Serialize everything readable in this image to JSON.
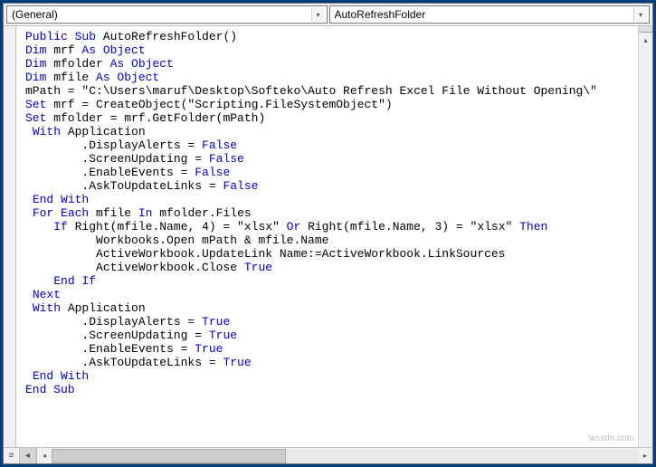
{
  "toolbar": {
    "object_dropdown": "(General)",
    "procedure_dropdown": "AutoRefreshFolder"
  },
  "code": {
    "lines": [
      [
        [
          "kw",
          "Public Sub"
        ],
        [
          "tok",
          " AutoRefreshFolder()"
        ]
      ],
      [
        [
          "kw",
          "Dim"
        ],
        [
          "tok",
          " mrf "
        ],
        [
          "kw",
          "As Object"
        ]
      ],
      [
        [
          "kw",
          "Dim"
        ],
        [
          "tok",
          " mfolder "
        ],
        [
          "kw",
          "As Object"
        ]
      ],
      [
        [
          "kw",
          "Dim"
        ],
        [
          "tok",
          " mfile "
        ],
        [
          "kw",
          "As Object"
        ]
      ],
      [
        [
          "tok",
          "mPath = \"C:\\Users\\maruf\\Desktop\\Softeko\\Auto Refresh Excel File Without Opening\\\""
        ]
      ],
      [
        [
          "kw",
          "Set"
        ],
        [
          "tok",
          " mrf = CreateObject(\"Scripting.FileSystemObject\")"
        ]
      ],
      [
        [
          "kw",
          "Set"
        ],
        [
          "tok",
          " mfolder = mrf.GetFolder(mPath)"
        ]
      ],
      [
        [
          "tok",
          " "
        ],
        [
          "kw",
          "With"
        ],
        [
          "tok",
          " Application"
        ]
      ],
      [
        [
          "tok",
          "        .DisplayAlerts = "
        ],
        [
          "kw",
          "False"
        ]
      ],
      [
        [
          "tok",
          "        .ScreenUpdating = "
        ],
        [
          "kw",
          "False"
        ]
      ],
      [
        [
          "tok",
          "        .EnableEvents = "
        ],
        [
          "kw",
          "False"
        ]
      ],
      [
        [
          "tok",
          "        .AskToUpdateLinks = "
        ],
        [
          "kw",
          "False"
        ]
      ],
      [
        [
          "tok",
          " "
        ],
        [
          "kw",
          "End With"
        ]
      ],
      [
        [
          "tok",
          " "
        ],
        [
          "kw",
          "For Each"
        ],
        [
          "tok",
          " mfile "
        ],
        [
          "kw",
          "In"
        ],
        [
          "tok",
          " mfolder.Files"
        ]
      ],
      [
        [
          "tok",
          "    "
        ],
        [
          "kw",
          "If"
        ],
        [
          "tok",
          " Right(mfile.Name, 4) = \"xlsx\" "
        ],
        [
          "kw",
          "Or"
        ],
        [
          "tok",
          " Right(mfile.Name, 3) = \"xlsx\" "
        ],
        [
          "kw",
          "Then"
        ]
      ],
      [
        [
          "tok",
          "          Workbooks.Open mPath & mfile.Name"
        ]
      ],
      [
        [
          "tok",
          "          ActiveWorkbook.UpdateLink Name:=ActiveWorkbook.LinkSources"
        ]
      ],
      [
        [
          "tok",
          "          ActiveWorkbook.Close "
        ],
        [
          "kw",
          "True"
        ]
      ],
      [
        [
          "tok",
          "    "
        ],
        [
          "kw",
          "End If"
        ]
      ],
      [
        [
          "tok",
          " "
        ],
        [
          "kw",
          "Next"
        ]
      ],
      [
        [
          "tok",
          " "
        ],
        [
          "kw",
          "With"
        ],
        [
          "tok",
          " Application"
        ]
      ],
      [
        [
          "tok",
          "        .DisplayAlerts = "
        ],
        [
          "kw",
          "True"
        ]
      ],
      [
        [
          "tok",
          "        .ScreenUpdating = "
        ],
        [
          "kw",
          "True"
        ]
      ],
      [
        [
          "tok",
          "        .EnableEvents = "
        ],
        [
          "kw",
          "True"
        ]
      ],
      [
        [
          "tok",
          "        .AskToUpdateLinks = "
        ],
        [
          "kw",
          "True"
        ]
      ],
      [
        [
          "tok",
          " "
        ],
        [
          "kw",
          "End With"
        ]
      ],
      [
        [
          "tok",
          ""
        ]
      ],
      [
        [
          "kw",
          "End Sub"
        ]
      ]
    ]
  },
  "watermark": "wsxdn.com"
}
